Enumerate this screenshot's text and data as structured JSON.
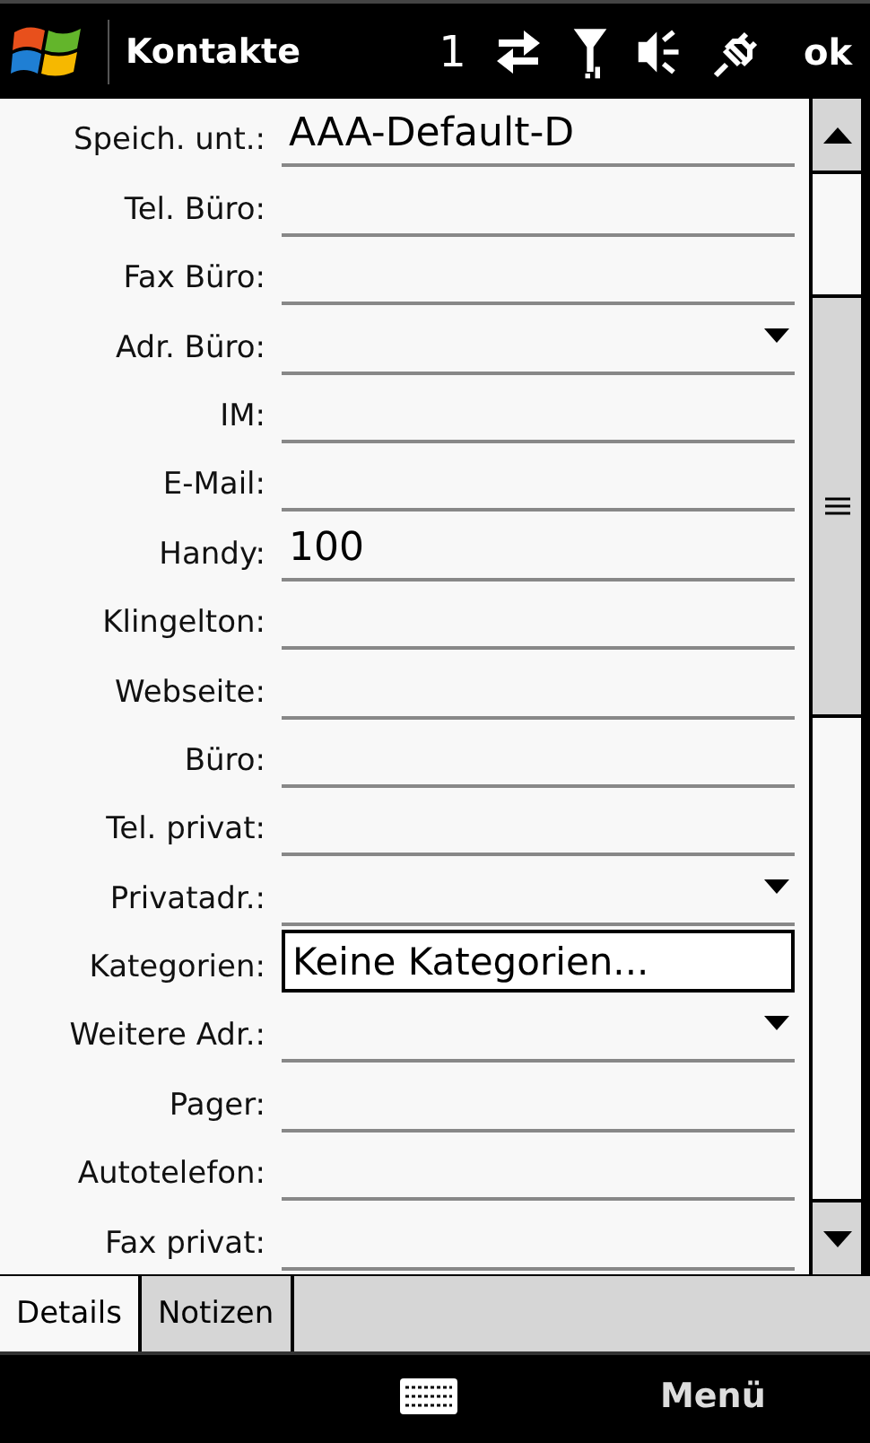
{
  "title_bar": {
    "title": "Kontakte",
    "notification_count": "1",
    "ok": "ok"
  },
  "fields": [
    {
      "label": "Speich. unt.:",
      "kind": "text",
      "value": "AAA-Default-D"
    },
    {
      "label": "Tel. Büro:",
      "kind": "text"
    },
    {
      "label": "Fax Büro:",
      "kind": "text"
    },
    {
      "label": "Adr. Büro:",
      "kind": "dropdown"
    },
    {
      "label": "IM:",
      "kind": "text"
    },
    {
      "label": "E-Mail:",
      "kind": "text"
    },
    {
      "label": "Handy:",
      "kind": "text",
      "value": "100"
    },
    {
      "label": "Klingelton:",
      "kind": "text"
    },
    {
      "label": "Webseite:",
      "kind": "text"
    },
    {
      "label": "Büro:",
      "kind": "text"
    },
    {
      "label": "Tel. privat:",
      "kind": "text"
    },
    {
      "label": "Privatadr.:",
      "kind": "dropdown"
    },
    {
      "label": "Kategorien:",
      "kind": "button",
      "value": "Keine Kategorien..."
    },
    {
      "label": "Weitere Adr.:",
      "kind": "dropdown"
    },
    {
      "label": "Pager:",
      "kind": "text"
    },
    {
      "label": "Autotelefon:",
      "kind": "text"
    },
    {
      "label": "Fax privat:",
      "kind": "text"
    }
  ],
  "tabs": [
    {
      "label": "Details",
      "selected": true
    },
    {
      "label": "Notizen",
      "selected": false
    }
  ],
  "soft_keys": {
    "right": "Menü"
  }
}
